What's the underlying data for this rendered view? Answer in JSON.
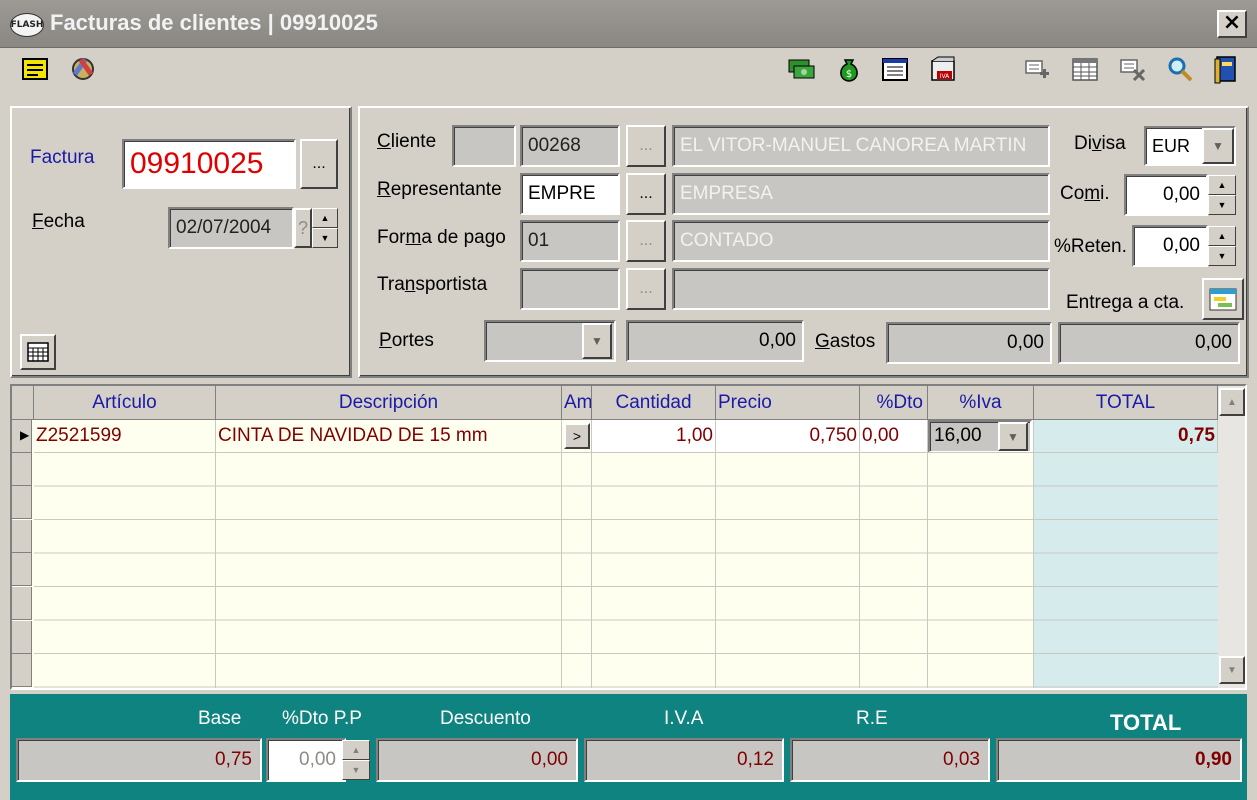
{
  "window": {
    "logo_text": "FLASH",
    "title": "Facturas de clientes | 09910025",
    "close_glyph": "×"
  },
  "toolbar_left": [
    {
      "name": "notes-icon"
    },
    {
      "name": "tools-icon"
    }
  ],
  "toolbar_right": [
    {
      "name": "money-exchange-icon"
    },
    {
      "name": "money-bag-icon"
    },
    {
      "name": "document-list-icon"
    },
    {
      "name": "iva-icon"
    },
    {
      "name": "add-line-icon"
    },
    {
      "name": "grid-icon"
    },
    {
      "name": "delete-line-icon"
    },
    {
      "name": "search-icon"
    },
    {
      "name": "book-icon"
    }
  ],
  "header": {
    "factura_label": "Factura",
    "factura_value": "09910025",
    "ellipsis": "...",
    "fecha_label": "Fecha",
    "fecha_value": "02/07/2004",
    "spin_question": "?",
    "cliente_label": "Cliente",
    "cliente_code": "00268",
    "cliente_name": "EL VITOR-MANUEL CANOREA MARTIN",
    "representante_label": "Representante",
    "representante_code": "EMPRE",
    "representante_name": "EMPRESA",
    "forma_pago_label": "Forma de pago",
    "forma_pago_code": "01",
    "forma_pago_name": "CONTADO",
    "transportista_label": "Transportista",
    "portes_label": "Portes",
    "portes_value": "0,00",
    "gastos_label": "Gastos",
    "gastos_value": "0,00",
    "entrega_value": "0,00",
    "divisa_label": "Divisa",
    "divisa_value": "EUR",
    "comi_label": "Comi.",
    "comi_value": "0,00",
    "reten_label": "%Reten.",
    "reten_value": "0,00",
    "entrega_label": "Entrega a cta."
  },
  "grid": {
    "columns": [
      "Artículo",
      "Descripción",
      "Am",
      "Cantidad",
      "Precio",
      "%Dto",
      "%Iva",
      "TOTAL"
    ],
    "rows": [
      {
        "articulo": "Z2521599",
        "descripcion": "CINTA DE NAVIDAD DE 15 mm",
        "am": ">",
        "cantidad": "1,00",
        "precio": "0,750",
        "dto": "0,00",
        "iva": "16,00",
        "total": "0,75"
      }
    ]
  },
  "footer": {
    "labels": [
      "Base",
      "%Dto P.P",
      "Descuento",
      "I.V.A",
      "R.E",
      "TOTAL"
    ],
    "base": "0,75",
    "dto_pp": "0,00",
    "descuento": "0,00",
    "iva": "0,12",
    "re": "0,03",
    "total": "0,90"
  },
  "colors": {
    "window_bg": "#d4d0c8",
    "factura_red": "#e00000",
    "label_blue": "#1a1aa6",
    "value_maroon": "#800000",
    "footer_teal": "#0e837f",
    "total_column_bg": "#d6ebeb"
  }
}
